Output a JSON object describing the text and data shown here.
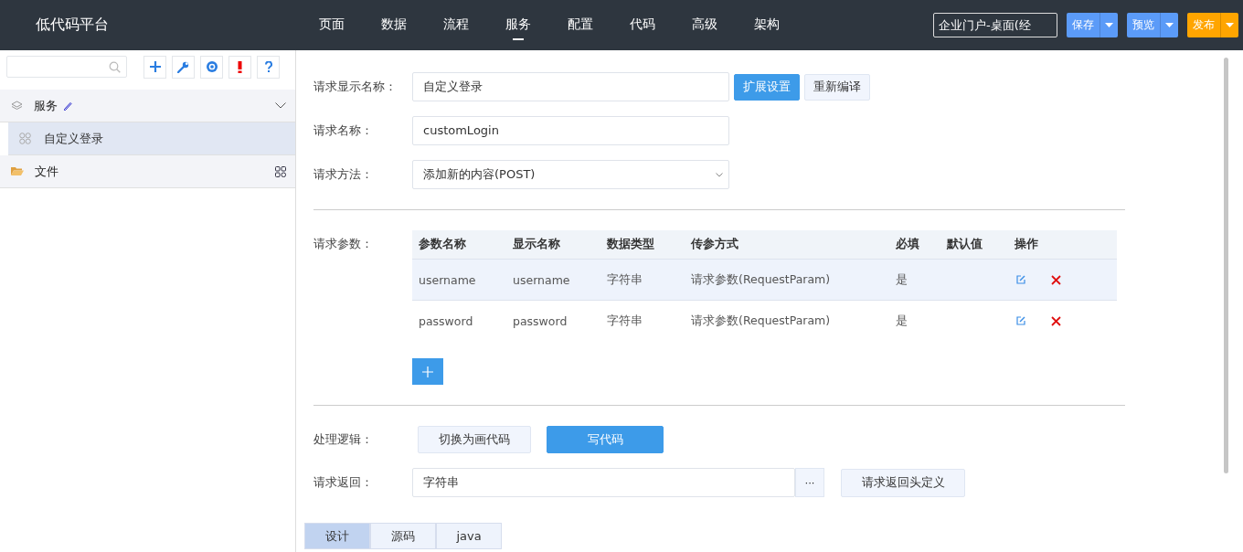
{
  "app_title": "低代码平台",
  "nav": [
    {
      "label": "页面",
      "selected": false
    },
    {
      "label": "数据",
      "selected": false
    },
    {
      "label": "流程",
      "selected": false
    },
    {
      "label": "服务",
      "selected": true
    },
    {
      "label": "配置",
      "selected": false
    },
    {
      "label": "代码",
      "selected": false
    },
    {
      "label": "高级",
      "selected": false
    },
    {
      "label": "架构",
      "selected": false
    }
  ],
  "project_select": "企业门户-桌面(经",
  "actions": [
    {
      "label": "保存",
      "kind": "blue"
    },
    {
      "label": "预览",
      "kind": "blue"
    },
    {
      "label": "发布",
      "kind": "orange"
    }
  ],
  "sidebar": {
    "tree": [
      {
        "label": "服务",
        "kind": "group",
        "expanded": true,
        "children": [
          {
            "label": "自定义登录",
            "selected": true
          }
        ]
      },
      {
        "label": "文件",
        "kind": "folder",
        "expanded": false
      }
    ]
  },
  "form": {
    "display_name": {
      "label": "请求显示名称：",
      "value": "自定义登录"
    },
    "ext_buttons": [
      "扩展设置",
      "重新编译"
    ],
    "name": {
      "label": "请求名称：",
      "value": "customLogin"
    },
    "method": {
      "label": "请求方法：",
      "value": "添加新的内容(POST)"
    },
    "params_label": "请求参数：",
    "columns": [
      "参数名称",
      "显示名称",
      "数据类型",
      "传参方式",
      "必填",
      "默认值",
      "操作"
    ],
    "rows": [
      {
        "cells": [
          "username",
          "username",
          "字符串",
          "请求参数(RequestParam)",
          "是",
          ""
        ],
        "selected": true
      },
      {
        "cells": [
          "password",
          "password",
          "字符串",
          "请求参数(RequestParam)",
          "是",
          ""
        ],
        "selected": false
      }
    ],
    "logic_label": "处理逻辑：",
    "logic_options": [
      {
        "label": "切换为画代码",
        "selected": false
      },
      {
        "label": "写代码",
        "selected": true
      }
    ],
    "return": {
      "label": "请求返回：",
      "value": "字符串",
      "more": "···",
      "header_button": "请求返回头定义"
    }
  },
  "bottom_tabs": [
    {
      "label": "设计",
      "selected": true
    },
    {
      "label": "源码",
      "selected": false
    },
    {
      "label": "java",
      "selected": false
    }
  ]
}
